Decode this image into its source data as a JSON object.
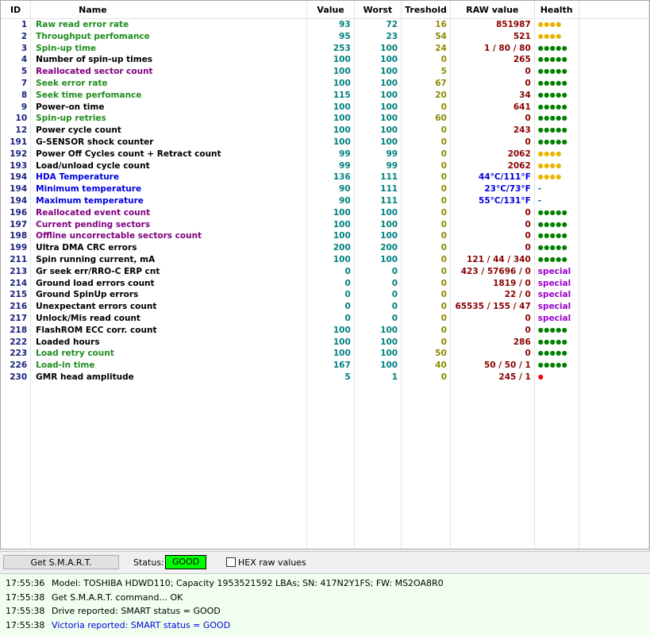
{
  "colors": {
    "green": "#1e8e1e",
    "black": "#000000",
    "purple": "#800080",
    "blue": "#0000e0",
    "value": "#008080",
    "thresh": "#8b8b00",
    "raw": "#8b0000",
    "dots_green": "#008000",
    "dots_yellow": "#e8b400",
    "dots_red": "#ff0000",
    "special": "#9900cc",
    "dash": "#008080"
  },
  "columns": [
    "ID",
    "Name",
    "Value",
    "Worst",
    "Treshold",
    "RAW value",
    "Health"
  ],
  "rows": [
    {
      "id": "1",
      "name": "Raw read error rate",
      "nc": "green",
      "value": "93",
      "worst": "72",
      "thresh": "16",
      "raw": "851987",
      "health": "●●●●",
      "hc": "dots_yellow"
    },
    {
      "id": "2",
      "name": "Throughput perfomance",
      "nc": "green",
      "value": "95",
      "worst": "23",
      "thresh": "54",
      "raw": "521",
      "health": "●●●●",
      "hc": "dots_yellow"
    },
    {
      "id": "3",
      "name": "Spin-up time",
      "nc": "green",
      "value": "253",
      "worst": "100",
      "thresh": "24",
      "raw": "1 / 80 / 80",
      "health": "●●●●●",
      "hc": "dots_green"
    },
    {
      "id": "4",
      "name": "Number of spin-up times",
      "nc": "black",
      "value": "100",
      "worst": "100",
      "thresh": "0",
      "raw": "265",
      "health": "●●●●●",
      "hc": "dots_green"
    },
    {
      "id": "5",
      "name": "Reallocated sector count",
      "nc": "purple",
      "value": "100",
      "worst": "100",
      "thresh": "5",
      "raw": "0",
      "health": "●●●●●",
      "hc": "dots_green"
    },
    {
      "id": "7",
      "name": "Seek error rate",
      "nc": "green",
      "value": "100",
      "worst": "100",
      "thresh": "67",
      "raw": "0",
      "health": "●●●●●",
      "hc": "dots_green"
    },
    {
      "id": "8",
      "name": "Seek time perfomance",
      "nc": "green",
      "value": "115",
      "worst": "100",
      "thresh": "20",
      "raw": "34",
      "health": "●●●●●",
      "hc": "dots_green"
    },
    {
      "id": "9",
      "name": "Power-on time",
      "nc": "black",
      "value": "100",
      "worst": "100",
      "thresh": "0",
      "raw": "641",
      "health": "●●●●●",
      "hc": "dots_green"
    },
    {
      "id": "10",
      "name": "Spin-up retries",
      "nc": "green",
      "value": "100",
      "worst": "100",
      "thresh": "60",
      "raw": "0",
      "health": "●●●●●",
      "hc": "dots_green"
    },
    {
      "id": "12",
      "name": "Power cycle count",
      "nc": "black",
      "value": "100",
      "worst": "100",
      "thresh": "0",
      "raw": "243",
      "health": "●●●●●",
      "hc": "dots_green"
    },
    {
      "id": "191",
      "name": "G-SENSOR shock counter",
      "nc": "black",
      "value": "100",
      "worst": "100",
      "thresh": "0",
      "raw": "0",
      "health": "●●●●●",
      "hc": "dots_green"
    },
    {
      "id": "192",
      "name": "Power Off Cycles count + Retract count",
      "nc": "black",
      "value": "99",
      "worst": "99",
      "thresh": "0",
      "raw": "2062",
      "health": "●●●●",
      "hc": "dots_yellow"
    },
    {
      "id": "193",
      "name": "Load/unload cycle count",
      "nc": "black",
      "value": "99",
      "worst": "99",
      "thresh": "0",
      "raw": "2062",
      "health": "●●●●",
      "hc": "dots_yellow"
    },
    {
      "id": "194",
      "name": "HDA Temperature",
      "nc": "blue",
      "value": "136",
      "worst": "111",
      "thresh": "0",
      "raw": "44°C/111°F",
      "health": "●●●●",
      "hc": "dots_yellow",
      "rc": "blue"
    },
    {
      "id": "194",
      "name": "Minimum temperature",
      "nc": "blue",
      "value": "90",
      "worst": "111",
      "thresh": "0",
      "raw": "23°C/73°F",
      "health": "-",
      "hc": "dash",
      "rc": "blue"
    },
    {
      "id": "194",
      "name": "Maximum temperature",
      "nc": "blue",
      "value": "90",
      "worst": "111",
      "thresh": "0",
      "raw": "55°C/131°F",
      "health": "-",
      "hc": "dash",
      "rc": "blue"
    },
    {
      "id": "196",
      "name": "Reallocated event count",
      "nc": "purple",
      "value": "100",
      "worst": "100",
      "thresh": "0",
      "raw": "0",
      "health": "●●●●●",
      "hc": "dots_green"
    },
    {
      "id": "197",
      "name": "Current pending sectors",
      "nc": "purple",
      "value": "100",
      "worst": "100",
      "thresh": "0",
      "raw": "0",
      "health": "●●●●●",
      "hc": "dots_green"
    },
    {
      "id": "198",
      "name": "Offline uncorrectable sectors count",
      "nc": "purple",
      "value": "100",
      "worst": "100",
      "thresh": "0",
      "raw": "0",
      "health": "●●●●●",
      "hc": "dots_green"
    },
    {
      "id": "199",
      "name": "Ultra DMA CRC errors",
      "nc": "black",
      "value": "200",
      "worst": "200",
      "thresh": "0",
      "raw": "0",
      "health": "●●●●●",
      "hc": "dots_green"
    },
    {
      "id": "211",
      "name": "Spin running current, mA",
      "nc": "black",
      "value": "100",
      "worst": "100",
      "thresh": "0",
      "raw": "121 / 44 / 340",
      "health": "●●●●●",
      "hc": "dots_green"
    },
    {
      "id": "213",
      "name": "Gr seek err/RRO-C ERP cnt",
      "nc": "black",
      "value": "0",
      "worst": "0",
      "thresh": "0",
      "raw": "423 / 57696 / 0",
      "health": "special",
      "hc": "special"
    },
    {
      "id": "214",
      "name": "Ground load errors count",
      "nc": "black",
      "value": "0",
      "worst": "0",
      "thresh": "0",
      "raw": "1819 / 0",
      "health": "special",
      "hc": "special"
    },
    {
      "id": "215",
      "name": "Ground SpinUp errors",
      "nc": "black",
      "value": "0",
      "worst": "0",
      "thresh": "0",
      "raw": "22 / 0",
      "health": "special",
      "hc": "special"
    },
    {
      "id": "216",
      "name": "Unexpectant errors count",
      "nc": "black",
      "value": "0",
      "worst": "0",
      "thresh": "0",
      "raw": "65535 / 155 / 47",
      "health": "special",
      "hc": "special"
    },
    {
      "id": "217",
      "name": "Unlock/Mis read count",
      "nc": "black",
      "value": "0",
      "worst": "0",
      "thresh": "0",
      "raw": "0",
      "health": "special",
      "hc": "special"
    },
    {
      "id": "218",
      "name": "FlashROM ECC corr. count",
      "nc": "black",
      "value": "100",
      "worst": "100",
      "thresh": "0",
      "raw": "0",
      "health": "●●●●●",
      "hc": "dots_green"
    },
    {
      "id": "222",
      "name": "Loaded hours",
      "nc": "black",
      "value": "100",
      "worst": "100",
      "thresh": "0",
      "raw": "286",
      "health": "●●●●●",
      "hc": "dots_green"
    },
    {
      "id": "223",
      "name": "Load retry count",
      "nc": "green",
      "value": "100",
      "worst": "100",
      "thresh": "50",
      "raw": "0",
      "health": "●●●●●",
      "hc": "dots_green"
    },
    {
      "id": "226",
      "name": "Load-in time",
      "nc": "green",
      "value": "167",
      "worst": "100",
      "thresh": "40",
      "raw": "50 / 50 / 1",
      "health": "●●●●●",
      "hc": "dots_green"
    },
    {
      "id": "230",
      "name": "GMR head amplitude",
      "nc": "black",
      "value": "5",
      "worst": "1",
      "thresh": "0",
      "raw": "245 / 1",
      "health": "●",
      "hc": "dots_red"
    }
  ],
  "toolbar": {
    "get_smart_label": "Get S.M.A.R.T.",
    "status_label": "Status:",
    "status_value": "GOOD",
    "hex_label": "HEX raw values"
  },
  "log": [
    {
      "time": "17:55:36",
      "msg": "Model: TOSHIBA HDWD110; Capacity 1953521592 LBAs; SN: 417N2Y1FS; FW: MS2OA8R0",
      "color": "#000000"
    },
    {
      "time": "17:55:38",
      "msg": "Get S.M.A.R.T. command... OK",
      "color": "#000000"
    },
    {
      "time": "17:55:38",
      "msg": "Drive reported: SMART status = GOOD",
      "color": "#000000"
    },
    {
      "time": "17:55:38",
      "msg": "Victoria reported: SMART status = GOOD",
      "color": "#0000e0"
    }
  ]
}
